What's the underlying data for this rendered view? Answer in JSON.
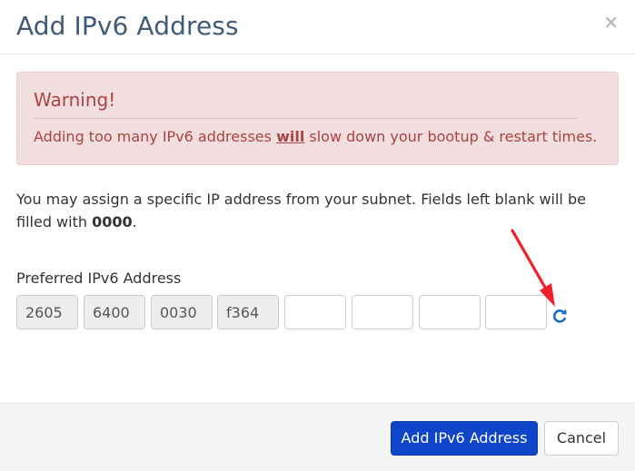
{
  "dialog": {
    "title": "Add IPv6 Address",
    "close_symbol": "×"
  },
  "warning": {
    "heading": "Warning!",
    "text_before": "Adding too many IPv6 addresses ",
    "text_emphasis": "will",
    "text_after": " slow down your bootup & restart times."
  },
  "intro": {
    "text": "You may assign a specific IP address from your subnet. Fields left blank will be filled with ",
    "bold_value": "0000",
    "text_end": "."
  },
  "address": {
    "label": "Preferred IPv6 Address",
    "segments": [
      {
        "value": "2605",
        "readonly": true
      },
      {
        "value": "6400",
        "readonly": true
      },
      {
        "value": "0030",
        "readonly": true
      },
      {
        "value": "f364",
        "readonly": true
      },
      {
        "value": "",
        "readonly": false
      },
      {
        "value": "",
        "readonly": false
      },
      {
        "value": "",
        "readonly": false
      },
      {
        "value": "",
        "readonly": false
      }
    ],
    "refresh_icon": "refresh-icon"
  },
  "annotation": {
    "arrow_color": "#f0202a"
  },
  "footer": {
    "primary_label": "Add IPv6 Address",
    "cancel_label": "Cancel"
  },
  "colors": {
    "title": "#3f5b77",
    "warning_bg": "#f2dede",
    "warning_text": "#a94442",
    "primary_button": "#0e45c9",
    "icon_blue": "#1a6fc9"
  }
}
